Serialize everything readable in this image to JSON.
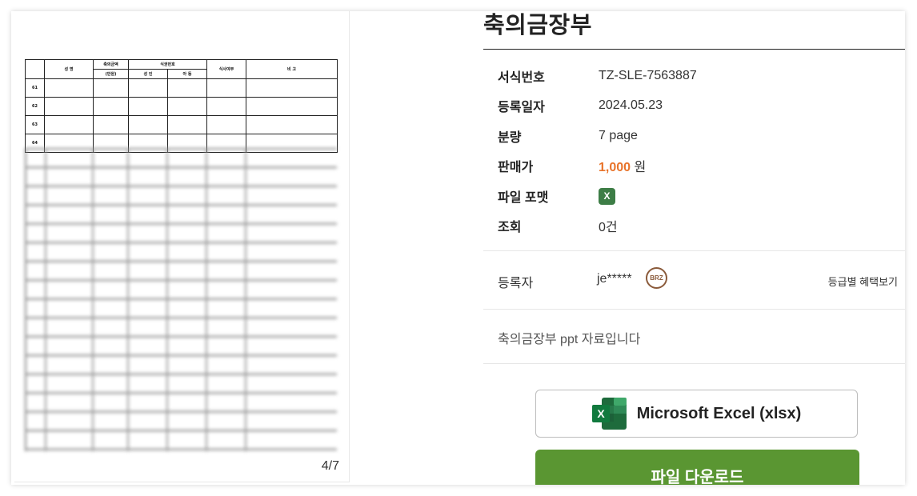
{
  "preview": {
    "page_indicator": "4/7",
    "table_headers": {
      "name": "성 명",
      "amount": "축의금액",
      "amount_unit": "(만원)",
      "ticket": "식권번호",
      "adult": "성 인",
      "child": "아 동",
      "meal": "식사여부",
      "note": "비 고"
    },
    "row_numbers": [
      "61",
      "62",
      "63",
      "64"
    ]
  },
  "detail": {
    "title": "축의금장부",
    "rows": [
      {
        "label": "서식번호",
        "value": "TZ-SLE-7563887"
      },
      {
        "label": "등록일자",
        "value": "2024.05.23"
      },
      {
        "label": "분량",
        "value": "7 page"
      },
      {
        "label": "판매가",
        "price": "1,000",
        "currency": "원"
      },
      {
        "label": "파일 포맷",
        "badge": "X"
      },
      {
        "label": "조회",
        "value": "0건"
      }
    ],
    "registrant_label": "등록자",
    "registrant_value": "je*****",
    "grade_badge": "BRZ",
    "grade_link": "등급별 혜택보기",
    "description": "축의금장부 ppt 자료입니다",
    "format_label": "Microsoft Excel (xlsx)",
    "download_label": "파일 다운로드"
  },
  "colors": {
    "price": "#e8732a",
    "excel_green": "#3d7d46",
    "download_green": "#5a9632"
  }
}
